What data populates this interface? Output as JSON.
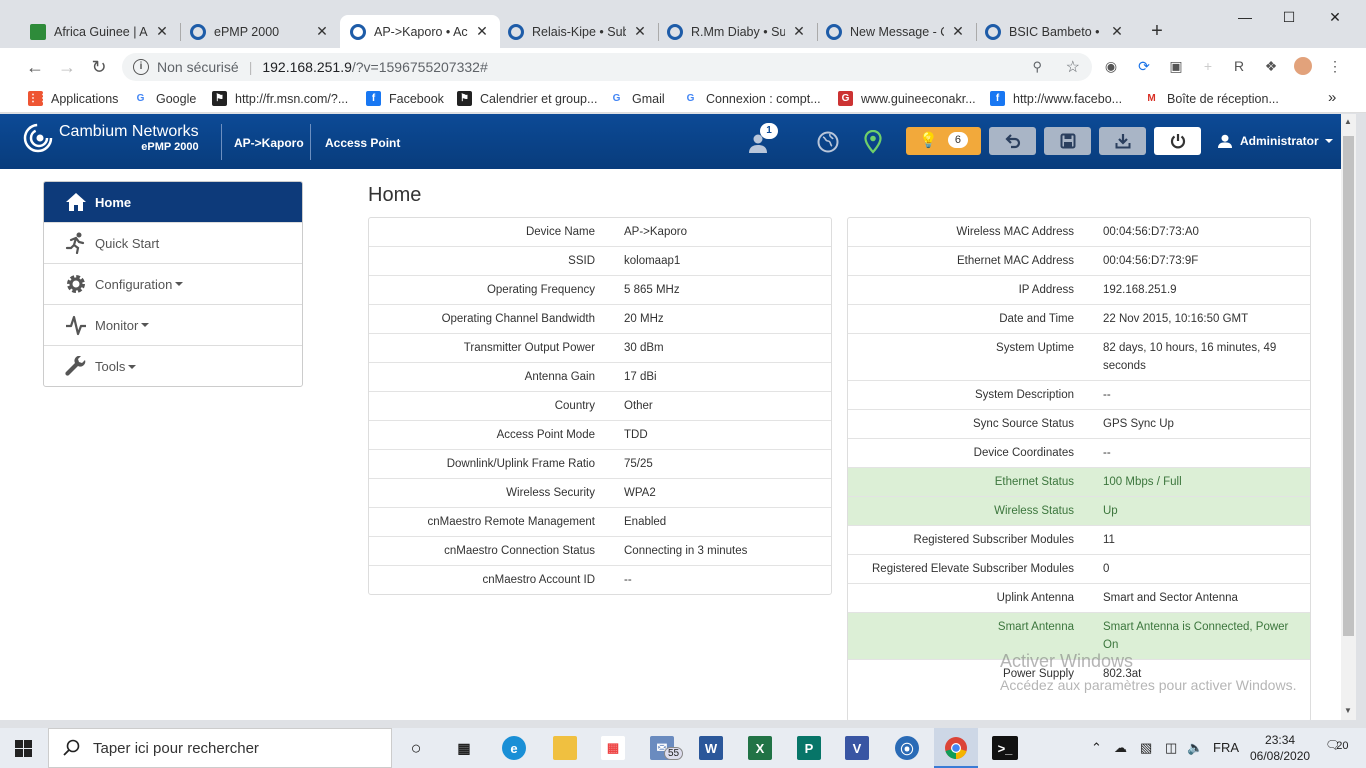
{
  "browser": {
    "tabs": [
      {
        "label": "Africa Guinee | Ac",
        "close": "✕",
        "favicon_color": "#2e8b3a"
      },
      {
        "label": "ePMP 2000",
        "close": "✕",
        "favicon_color": "#1e5ca8"
      },
      {
        "label": "AP->Kaporo • Acc",
        "close": "✕",
        "favicon_color": "#1e5ca8"
      },
      {
        "label": "Relais-Kipe • Subs",
        "close": "✕",
        "favicon_color": "#1e5ca8"
      },
      {
        "label": "R.Mm Diaby • Sub",
        "close": "✕",
        "favicon_color": "#1e5ca8"
      },
      {
        "label": "New Message - C",
        "close": "✕",
        "favicon_color": "#1e5ca8"
      },
      {
        "label": "BSIC Bambeto •",
        "close": "✕",
        "favicon_color": "#1e5ca8"
      }
    ],
    "new_tab": "+",
    "window_controls": {
      "minimize": "—",
      "maximize": "☐",
      "close": "✕"
    },
    "address": {
      "security": "Non sécurisé",
      "host": "192.168.251.9",
      "path": "/?v=1596755207332#"
    },
    "bookmarks": [
      {
        "label": "Applications",
        "icon": "apps-grid-icon"
      },
      {
        "label": "Google",
        "icon": "google-icon"
      },
      {
        "label": "http://fr.msn.com/?...",
        "icon": "msn-icon"
      },
      {
        "label": "Facebook",
        "icon": "facebook-icon"
      },
      {
        "label": "Calendrier et group...",
        "icon": "calendar-icon"
      },
      {
        "label": "Gmail",
        "icon": "google-icon"
      },
      {
        "label": "Connexion : compt...",
        "icon": "google-icon"
      },
      {
        "label": "www.guineeconakr...",
        "icon": "gci-icon"
      },
      {
        "label": "http://www.facebo...",
        "icon": "facebook-icon"
      },
      {
        "label": "Boîte de réception...",
        "icon": "gmail-icon"
      }
    ],
    "bookmarks_more": "»"
  },
  "header": {
    "brand": "Cambium Networks",
    "product": "ePMP 2000",
    "device": "AP->Kaporo",
    "mode": "Access Point",
    "notification_count": "1",
    "alerts_count": "6",
    "user": "Administrator",
    "colors": {
      "header_bg": "#0c4a96",
      "alert_orange": "#f0a030",
      "btn_gray": "#a9b5c6"
    }
  },
  "sidebar": {
    "items": [
      {
        "label": "Home",
        "icon": "home-icon"
      },
      {
        "label": "Quick Start",
        "icon": "running-icon"
      },
      {
        "label": "Configuration",
        "icon": "gear-icon"
      },
      {
        "label": "Monitor",
        "icon": "pulse-icon"
      },
      {
        "label": "Tools",
        "icon": "wrench-icon"
      }
    ]
  },
  "main": {
    "title": "Home",
    "left_panel": [
      {
        "key": "Device Name",
        "value": "AP->Kaporo"
      },
      {
        "key": "SSID",
        "value": "kolomaap1"
      },
      {
        "key": "Operating Frequency",
        "value": "5 865 MHz"
      },
      {
        "key": "Operating Channel Bandwidth",
        "value": "20 MHz"
      },
      {
        "key": "Transmitter Output Power",
        "value": "30 dBm"
      },
      {
        "key": "Antenna Gain",
        "value": "17 dBi"
      },
      {
        "key": "Country",
        "value": "Other"
      },
      {
        "key": "Access Point Mode",
        "value": "TDD"
      },
      {
        "key": "Downlink/Uplink Frame Ratio",
        "value": "75/25"
      },
      {
        "key": "Wireless Security",
        "value": "WPA2"
      },
      {
        "key": "cnMaestro Remote Management",
        "value": "Enabled"
      },
      {
        "key": "cnMaestro Connection Status",
        "value": "Connecting in 3 minutes"
      },
      {
        "key": "cnMaestro Account ID",
        "value": "--"
      }
    ],
    "right_panel": [
      {
        "key": "Wireless MAC Address",
        "value": "00:04:56:D7:73:A0",
        "status": ""
      },
      {
        "key": "Ethernet MAC Address",
        "value": "00:04:56:D7:73:9F",
        "status": ""
      },
      {
        "key": "IP Address",
        "value": "192.168.251.9",
        "status": ""
      },
      {
        "key": "Date and Time",
        "value": "22 Nov 2015, 10:16:50 GMT",
        "status": ""
      },
      {
        "key": "System Uptime",
        "value": "82 days, 10 hours, 16 minutes, 49 seconds",
        "status": ""
      },
      {
        "key": "System Description",
        "value": "--",
        "status": ""
      },
      {
        "key": "Sync Source Status",
        "value": "GPS Sync Up",
        "status": ""
      },
      {
        "key": "Device Coordinates",
        "value": "--",
        "status": ""
      },
      {
        "key": "Ethernet Status",
        "value": "100 Mbps / Full",
        "status": "ok"
      },
      {
        "key": "Wireless Status",
        "value": "Up",
        "status": "ok"
      },
      {
        "key": "Registered Subscriber Modules",
        "value": "11",
        "status": ""
      },
      {
        "key": "Registered Elevate Subscriber Modules",
        "value": "0",
        "status": ""
      },
      {
        "key": "Uplink Antenna",
        "value": "Smart and Sector Antenna",
        "status": ""
      },
      {
        "key": "Smart Antenna",
        "value": "Smart Antenna is Connected, Power On",
        "status": "ok"
      },
      {
        "key": "Power Supply",
        "value": "802.3at",
        "status": ""
      }
    ]
  },
  "watermark": {
    "line1": "Activer Windows",
    "line2": "Accédez aux paramètres pour activer Windows."
  },
  "taskbar": {
    "search_placeholder": "Taper ici pour rechercher",
    "mail_badge": "55",
    "language": "FRA",
    "time": "23:34",
    "date": "06/08/2020",
    "notifications": "20"
  }
}
